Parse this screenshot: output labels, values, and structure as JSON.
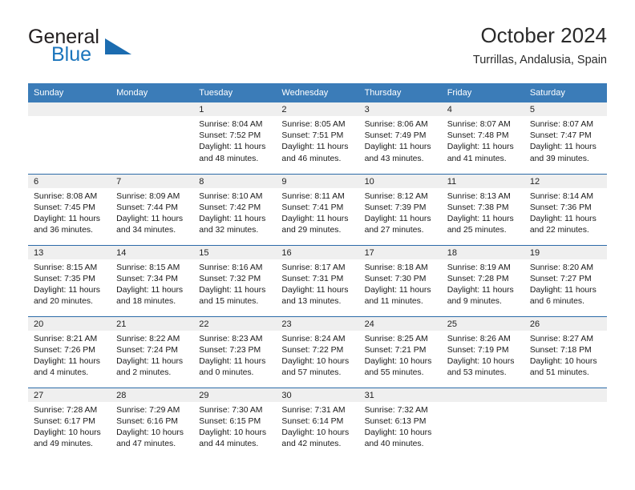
{
  "brand": {
    "name_top": "General",
    "name_bottom": "Blue",
    "accent_color": "#1b75bc",
    "triangle_color": "#1b6cb0"
  },
  "header": {
    "title": "October 2024",
    "subtitle": "Turrillas, Andalusia, Spain"
  },
  "theme": {
    "header_bg": "#3b7cb8",
    "row_divider": "#2c6ba8",
    "daynum_band_bg": "#efefef"
  },
  "weekday_headers": [
    "Sunday",
    "Monday",
    "Tuesday",
    "Wednesday",
    "Thursday",
    "Friday",
    "Saturday"
  ],
  "weeks": [
    [
      {
        "day": "",
        "sunrise": "",
        "sunset": "",
        "daylight_line1": "",
        "daylight_line2": "",
        "empty": true
      },
      {
        "day": "",
        "sunrise": "",
        "sunset": "",
        "daylight_line1": "",
        "daylight_line2": "",
        "empty": true
      },
      {
        "day": "1",
        "sunrise": "Sunrise: 8:04 AM",
        "sunset": "Sunset: 7:52 PM",
        "daylight_line1": "Daylight: 11 hours",
        "daylight_line2": "and 48 minutes."
      },
      {
        "day": "2",
        "sunrise": "Sunrise: 8:05 AM",
        "sunset": "Sunset: 7:51 PM",
        "daylight_line1": "Daylight: 11 hours",
        "daylight_line2": "and 46 minutes."
      },
      {
        "day": "3",
        "sunrise": "Sunrise: 8:06 AM",
        "sunset": "Sunset: 7:49 PM",
        "daylight_line1": "Daylight: 11 hours",
        "daylight_line2": "and 43 minutes."
      },
      {
        "day": "4",
        "sunrise": "Sunrise: 8:07 AM",
        "sunset": "Sunset: 7:48 PM",
        "daylight_line1": "Daylight: 11 hours",
        "daylight_line2": "and 41 minutes."
      },
      {
        "day": "5",
        "sunrise": "Sunrise: 8:07 AM",
        "sunset": "Sunset: 7:47 PM",
        "daylight_line1": "Daylight: 11 hours",
        "daylight_line2": "and 39 minutes."
      }
    ],
    [
      {
        "day": "6",
        "sunrise": "Sunrise: 8:08 AM",
        "sunset": "Sunset: 7:45 PM",
        "daylight_line1": "Daylight: 11 hours",
        "daylight_line2": "and 36 minutes."
      },
      {
        "day": "7",
        "sunrise": "Sunrise: 8:09 AM",
        "sunset": "Sunset: 7:44 PM",
        "daylight_line1": "Daylight: 11 hours",
        "daylight_line2": "and 34 minutes."
      },
      {
        "day": "8",
        "sunrise": "Sunrise: 8:10 AM",
        "sunset": "Sunset: 7:42 PM",
        "daylight_line1": "Daylight: 11 hours",
        "daylight_line2": "and 32 minutes."
      },
      {
        "day": "9",
        "sunrise": "Sunrise: 8:11 AM",
        "sunset": "Sunset: 7:41 PM",
        "daylight_line1": "Daylight: 11 hours",
        "daylight_line2": "and 29 minutes."
      },
      {
        "day": "10",
        "sunrise": "Sunrise: 8:12 AM",
        "sunset": "Sunset: 7:39 PM",
        "daylight_line1": "Daylight: 11 hours",
        "daylight_line2": "and 27 minutes."
      },
      {
        "day": "11",
        "sunrise": "Sunrise: 8:13 AM",
        "sunset": "Sunset: 7:38 PM",
        "daylight_line1": "Daylight: 11 hours",
        "daylight_line2": "and 25 minutes."
      },
      {
        "day": "12",
        "sunrise": "Sunrise: 8:14 AM",
        "sunset": "Sunset: 7:36 PM",
        "daylight_line1": "Daylight: 11 hours",
        "daylight_line2": "and 22 minutes."
      }
    ],
    [
      {
        "day": "13",
        "sunrise": "Sunrise: 8:15 AM",
        "sunset": "Sunset: 7:35 PM",
        "daylight_line1": "Daylight: 11 hours",
        "daylight_line2": "and 20 minutes."
      },
      {
        "day": "14",
        "sunrise": "Sunrise: 8:15 AM",
        "sunset": "Sunset: 7:34 PM",
        "daylight_line1": "Daylight: 11 hours",
        "daylight_line2": "and 18 minutes."
      },
      {
        "day": "15",
        "sunrise": "Sunrise: 8:16 AM",
        "sunset": "Sunset: 7:32 PM",
        "daylight_line1": "Daylight: 11 hours",
        "daylight_line2": "and 15 minutes."
      },
      {
        "day": "16",
        "sunrise": "Sunrise: 8:17 AM",
        "sunset": "Sunset: 7:31 PM",
        "daylight_line1": "Daylight: 11 hours",
        "daylight_line2": "and 13 minutes."
      },
      {
        "day": "17",
        "sunrise": "Sunrise: 8:18 AM",
        "sunset": "Sunset: 7:30 PM",
        "daylight_line1": "Daylight: 11 hours",
        "daylight_line2": "and 11 minutes."
      },
      {
        "day": "18",
        "sunrise": "Sunrise: 8:19 AM",
        "sunset": "Sunset: 7:28 PM",
        "daylight_line1": "Daylight: 11 hours",
        "daylight_line2": "and 9 minutes."
      },
      {
        "day": "19",
        "sunrise": "Sunrise: 8:20 AM",
        "sunset": "Sunset: 7:27 PM",
        "daylight_line1": "Daylight: 11 hours",
        "daylight_line2": "and 6 minutes."
      }
    ],
    [
      {
        "day": "20",
        "sunrise": "Sunrise: 8:21 AM",
        "sunset": "Sunset: 7:26 PM",
        "daylight_line1": "Daylight: 11 hours",
        "daylight_line2": "and 4 minutes."
      },
      {
        "day": "21",
        "sunrise": "Sunrise: 8:22 AM",
        "sunset": "Sunset: 7:24 PM",
        "daylight_line1": "Daylight: 11 hours",
        "daylight_line2": "and 2 minutes."
      },
      {
        "day": "22",
        "sunrise": "Sunrise: 8:23 AM",
        "sunset": "Sunset: 7:23 PM",
        "daylight_line1": "Daylight: 11 hours",
        "daylight_line2": "and 0 minutes."
      },
      {
        "day": "23",
        "sunrise": "Sunrise: 8:24 AM",
        "sunset": "Sunset: 7:22 PM",
        "daylight_line1": "Daylight: 10 hours",
        "daylight_line2": "and 57 minutes."
      },
      {
        "day": "24",
        "sunrise": "Sunrise: 8:25 AM",
        "sunset": "Sunset: 7:21 PM",
        "daylight_line1": "Daylight: 10 hours",
        "daylight_line2": "and 55 minutes."
      },
      {
        "day": "25",
        "sunrise": "Sunrise: 8:26 AM",
        "sunset": "Sunset: 7:19 PM",
        "daylight_line1": "Daylight: 10 hours",
        "daylight_line2": "and 53 minutes."
      },
      {
        "day": "26",
        "sunrise": "Sunrise: 8:27 AM",
        "sunset": "Sunset: 7:18 PM",
        "daylight_line1": "Daylight: 10 hours",
        "daylight_line2": "and 51 minutes."
      }
    ],
    [
      {
        "day": "27",
        "sunrise": "Sunrise: 7:28 AM",
        "sunset": "Sunset: 6:17 PM",
        "daylight_line1": "Daylight: 10 hours",
        "daylight_line2": "and 49 minutes."
      },
      {
        "day": "28",
        "sunrise": "Sunrise: 7:29 AM",
        "sunset": "Sunset: 6:16 PM",
        "daylight_line1": "Daylight: 10 hours",
        "daylight_line2": "and 47 minutes."
      },
      {
        "day": "29",
        "sunrise": "Sunrise: 7:30 AM",
        "sunset": "Sunset: 6:15 PM",
        "daylight_line1": "Daylight: 10 hours",
        "daylight_line2": "and 44 minutes."
      },
      {
        "day": "30",
        "sunrise": "Sunrise: 7:31 AM",
        "sunset": "Sunset: 6:14 PM",
        "daylight_line1": "Daylight: 10 hours",
        "daylight_line2": "and 42 minutes."
      },
      {
        "day": "31",
        "sunrise": "Sunrise: 7:32 AM",
        "sunset": "Sunset: 6:13 PM",
        "daylight_line1": "Daylight: 10 hours",
        "daylight_line2": "and 40 minutes."
      },
      {
        "day": "",
        "sunrise": "",
        "sunset": "",
        "daylight_line1": "",
        "daylight_line2": "",
        "empty": true
      },
      {
        "day": "",
        "sunrise": "",
        "sunset": "",
        "daylight_line1": "",
        "daylight_line2": "",
        "empty": true
      }
    ]
  ]
}
